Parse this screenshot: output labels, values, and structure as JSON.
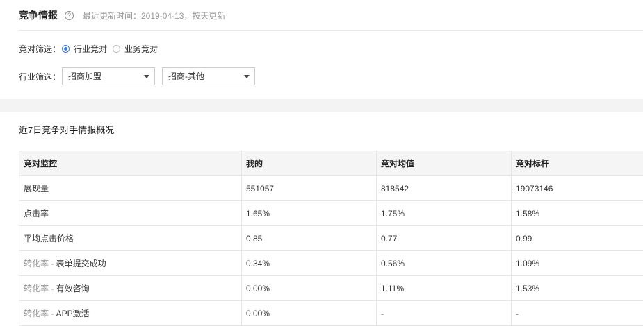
{
  "header": {
    "title": "竞争情报",
    "help_icon": "?",
    "updated": "最近更新时间：2019-04-13，按天更新"
  },
  "filters": {
    "rival_label": "竞对筛选：",
    "rival_options": [
      "行业竞对",
      "业务竞对"
    ],
    "rival_selected": "行业竞对",
    "industry_label": "行业筛选：",
    "industry_primary": "招商加盟",
    "industry_secondary": "招商-其他"
  },
  "summary": {
    "title": "近7日竞争对手情报概况",
    "columns": [
      "竞对监控",
      "我的",
      "竞对均值",
      "竞对标杆"
    ],
    "rows": [
      {
        "prefix": "",
        "label": "展现量",
        "values": [
          "551057",
          "818542",
          "19073146"
        ]
      },
      {
        "prefix": "",
        "label": "点击率",
        "values": [
          "1.65%",
          "1.75%",
          "1.58%"
        ]
      },
      {
        "prefix": "",
        "label": "平均点击价格",
        "values": [
          "0.85",
          "0.77",
          "0.99"
        ]
      },
      {
        "prefix": "转化率 - ",
        "label": "表单提交成功",
        "values": [
          "0.34%",
          "0.56%",
          "1.09%"
        ]
      },
      {
        "prefix": "转化率 - ",
        "label": "有效咨询",
        "values": [
          "0.00%",
          "1.11%",
          "1.53%"
        ]
      },
      {
        "prefix": "转化率 - ",
        "label": "APP激活",
        "values": [
          "0.00%",
          "-",
          "-"
        ]
      }
    ]
  }
}
